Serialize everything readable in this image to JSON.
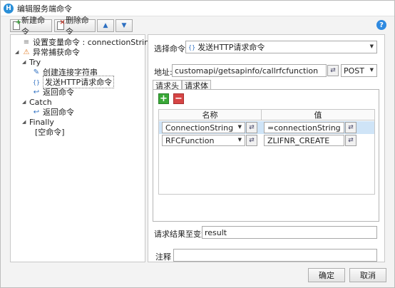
{
  "window": {
    "title": "编辑服务端命令",
    "app_icon_letter": "H"
  },
  "toolbar": {
    "new_label": "新建命令",
    "delete_label": "删除命令",
    "up_arrow": "▲",
    "down_arrow": "▼",
    "help": "?"
  },
  "tree": {
    "items": [
      {
        "label": "设置变量命令 : connectionString",
        "toggle": "",
        "icon": "≡"
      },
      {
        "label": "异常捕获命令",
        "toggle": "◢",
        "icon": "⚠"
      },
      {
        "label": "Try",
        "toggle": "◢",
        "icon": ""
      },
      {
        "label": "创建连接字符串",
        "toggle": "",
        "icon": "✎"
      },
      {
        "label": "发送HTTP请求命令",
        "toggle": "",
        "icon": "{}"
      },
      {
        "label": "返回命令",
        "toggle": "",
        "icon": "↩"
      },
      {
        "label": "Catch",
        "toggle": "◢",
        "icon": ""
      },
      {
        "label": "返回命令",
        "toggle": "",
        "icon": "↩"
      },
      {
        "label": "Finally",
        "toggle": "◢",
        "icon": ""
      },
      {
        "label": "[空命令]",
        "toggle": "",
        "icon": ""
      }
    ]
  },
  "form": {
    "select_command_label": "选择命令:",
    "select_command_icon": "{}",
    "select_command_value": "发送HTTP请求命令",
    "address_label": "地址:",
    "address_value": "customapi/getsapinfo/callrfcfunction",
    "method_value": "POST",
    "tabs": [
      "请求头",
      "请求体"
    ],
    "add_symbol": "+",
    "remove_symbol": "−",
    "grid_headers": [
      "名称",
      "值"
    ],
    "grid_rows": [
      {
        "name": "ConnectionString",
        "value": "=connectionString"
      },
      {
        "name": "RFCFunction",
        "value": "ZLIFNR_CREATE"
      }
    ],
    "result_label": "请求结果至变量:",
    "result_value": "result",
    "comment_label": "注释",
    "comment_value": ""
  },
  "footer": {
    "ok_label": "确定",
    "cancel_label": "取消"
  }
}
